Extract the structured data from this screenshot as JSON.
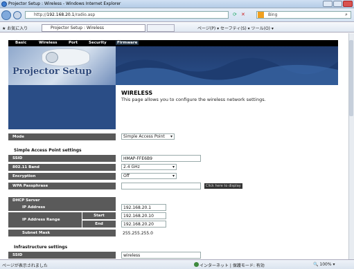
{
  "window": {
    "title": "Projector Setup : Wireless - Windows Internet Explorer"
  },
  "address": {
    "url_prefix": "http://",
    "url_host": "192.168.20.1",
    "url_path": "/radio.asp",
    "search_engine": "Bing"
  },
  "favorites": {
    "label": "お気に入り",
    "tab_title": "Projector Setup : Wireless",
    "tools": "ページ(P) ▾  セーフティ(S) ▾  ツール(O) ▾"
  },
  "nav": {
    "items": [
      "Basic",
      "Wireless",
      "Port",
      "Security",
      "Firmware"
    ]
  },
  "banner": {
    "logo": "Projector Setup"
  },
  "heading": {
    "title": "WIRELESS",
    "description": "This page allows you to configure the wireless network settings."
  },
  "mode": {
    "label": "Mode",
    "value": "Simple Access Point"
  },
  "simple_ap": {
    "section": "Simple Access Point settings",
    "ssid_label": "SSID",
    "ssid": "HMAP-FFE6B9",
    "band_label": "802.11 Band",
    "band": "2.4 GHz",
    "encryption_label": "Encryption",
    "encryption": "Off",
    "wpa_label": "WPA Passphrase",
    "wpa_value": "",
    "display_button": "Click here to display"
  },
  "dhcp": {
    "section": "DHCP Server",
    "ip_label": "IP Address",
    "ip": "192.168.20.1",
    "range_label": "IP Address Range",
    "start_label": "Start",
    "start": "192.168.20.10",
    "end_label": "End",
    "end": "192.168.20.20",
    "mask_label": "Subnet Mask",
    "mask": "255.255.255.0"
  },
  "infra": {
    "section": "Infrastructure settings",
    "ssid_label": "SSID",
    "ssid": "wireless"
  },
  "status": {
    "text": "ページが表示されました",
    "zone": "インターネット | 保護モード: 有効",
    "zoom": "100%"
  },
  "colors": {
    "label_bg": "#5a5a5a",
    "banner": "#29508c"
  }
}
